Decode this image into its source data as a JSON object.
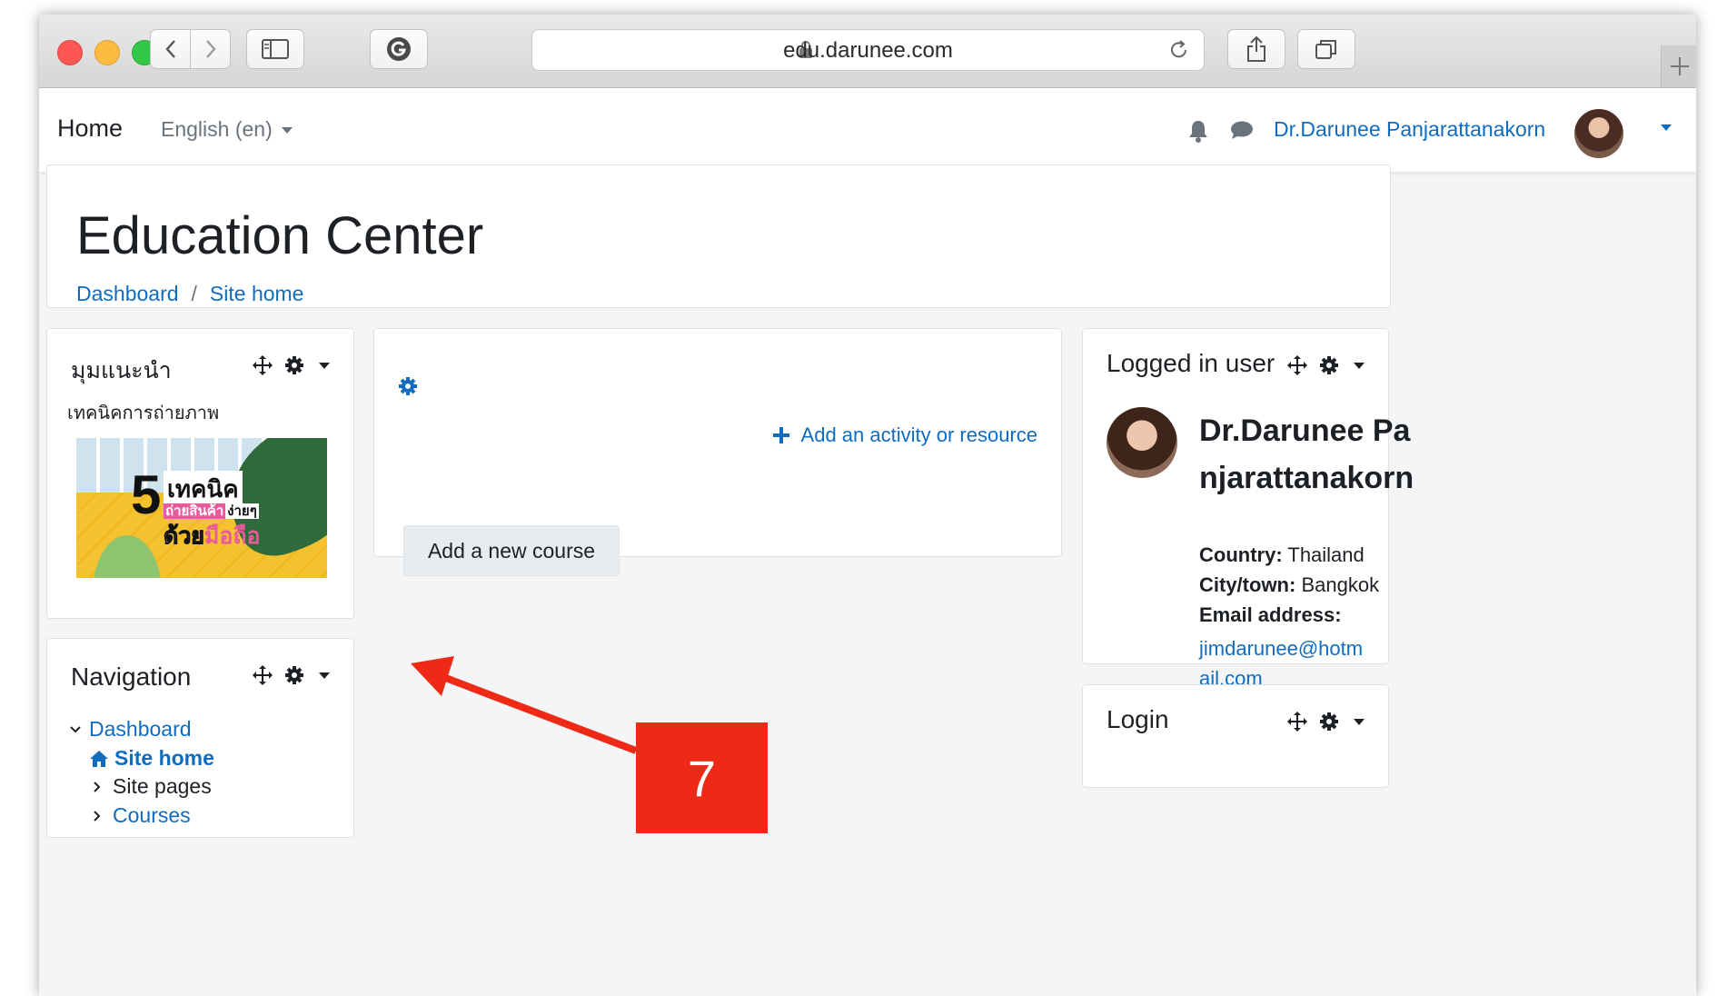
{
  "browser": {
    "url": "edu.darunee.com"
  },
  "navbar": {
    "brand": "Home",
    "language": "English (en)",
    "user_name": "Dr.Darunee Panjarattanakorn"
  },
  "header": {
    "title": "Education Center",
    "breadcrumbs": [
      "Dashboard",
      "Site home"
    ],
    "separator": "/"
  },
  "featured_block": {
    "title": "มุมแนะนำ",
    "subtitle": "เทคนิคการถ่ายภาพ",
    "image_text": {
      "number": "5",
      "line1": "เทคนิค",
      "line2_a": "ถ่ายสินค้า",
      "line2_b": "ง่ายๆ",
      "line3_a": "ด้วย",
      "line3_b": "มือถือ"
    }
  },
  "navigation_block": {
    "title": "Navigation",
    "items": [
      {
        "label": "Dashboard"
      },
      {
        "label": "Site home"
      },
      {
        "label": "Site pages"
      },
      {
        "label": "Courses"
      }
    ]
  },
  "main": {
    "add_activity": "Add an activity or resource",
    "add_course": "Add a new course"
  },
  "logged_in_block": {
    "title": "Logged in user",
    "name": "Dr.Darunee Panjarattanakorn",
    "country_label": "Country:",
    "country": "Thailand",
    "city_label": "City/town:",
    "city": "Bangkok",
    "email_label": "Email address:",
    "email": "jimdarunee@hotmail.com"
  },
  "login_block": {
    "title": "Login"
  },
  "annotation": {
    "label": "7",
    "color": "#ee2a16"
  },
  "colors": {
    "link": "#0f6cbf",
    "page_bg": "#f4f5f6"
  }
}
